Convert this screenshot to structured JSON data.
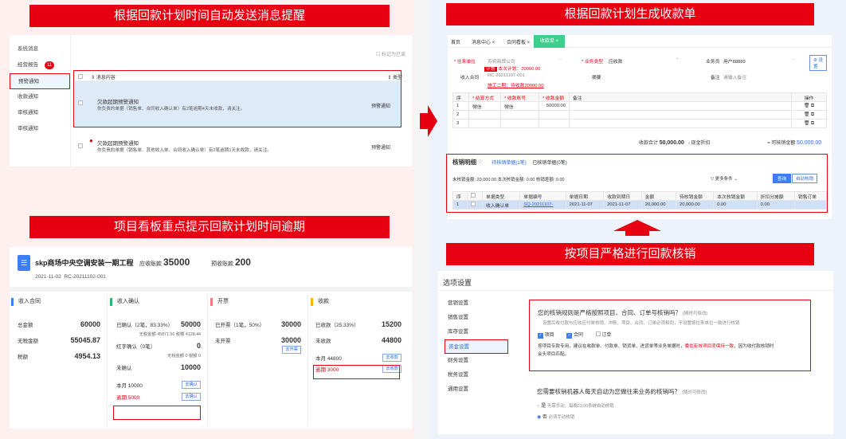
{
  "banners": {
    "b1": "根据回款计划时间自动发送消息提醒",
    "b2": "项目看板重点提示回款计划时间逾期",
    "b3": "根据回款计划生成收款单",
    "b4": "按项目严格进行回款核销"
  },
  "p1": {
    "sidebar": [
      {
        "label": "系统消息"
      },
      {
        "label": "经营报告",
        "badge": "11"
      },
      {
        "label": "预警通知"
      },
      {
        "label": "收款通知"
      },
      {
        "label": "审核通知"
      },
      {
        "label": "审核通知"
      }
    ],
    "mark_read": "标记为已读",
    "col_content": "消息内容",
    "col_type": "类型",
    "messages": [
      {
        "title": "欠款超期预警通知",
        "body": "你负责的单据（销售单、合同收入确认单）有2笔逾期4天未收款，请关注。",
        "type": "预警通知"
      },
      {
        "title": "欠款超期预警通知",
        "body": "你负责的单据（销售单、其他收入单、合同收入确认单）有2笔逾期1天未收款，请关注。",
        "type": "预警通知"
      }
    ]
  },
  "p2": {
    "title": "skp商场中央空调安装一期工程",
    "receivable_label": "应收账款",
    "receivable": "35000",
    "advance_label": "预收账款",
    "advance": "200",
    "date": "2021-11-02",
    "code": "RC-20211102-001",
    "cols": [
      {
        "head": "收入合同",
        "color": "#3d7df5",
        "rows": [
          {
            "k": "总金额",
            "v": "60000"
          },
          {
            "k": "无税金额",
            "v": "55045.87"
          },
          {
            "k": "税额",
            "v": "4954.13"
          }
        ]
      },
      {
        "head": "收入确认",
        "color": "#2bb673"
      },
      {
        "head": "开票",
        "color": "#f07c82",
        "rows": [
          {
            "k": "已开票（1笔，50%）",
            "v": "30000"
          },
          {
            "k": "未开票",
            "v": "30000"
          }
        ],
        "btn": "去开票"
      },
      {
        "head": "收款",
        "color": "#f5b400",
        "rows": [
          {
            "k": "已收款（25.33%）",
            "v": "15200"
          },
          {
            "k": "未收款",
            "v": "44800"
          }
        ]
      }
    ],
    "confirm": {
      "confirmed": "已确认（2笔，83.33%）",
      "confirmed_v": "50000",
      "no_tax": "无税金额 45871.56 税额 4128.44",
      "red": "红字确认（0笔）",
      "red_v": "0",
      "red_sub": "无税金额 0 税额 0",
      "unconfirmed": "未确认",
      "unconfirmed_v": "10000",
      "month": "本月 10000",
      "overdue": "逾期 5000",
      "btn1": "去确认",
      "btn2": "去确认"
    },
    "collect": {
      "month": "本月 44800",
      "overdue": "逾期 3000",
      "btn1": "去收款",
      "btn2": "去收款"
    }
  },
  "p3": {
    "tabs": [
      "首页",
      "消息中心 ×",
      "合同看板 ×",
      "收款单 ×"
    ],
    "f_unit_label": "* 往来单位",
    "f_unit_val": "苏玥商贸公司",
    "f_plan_tag": "计划",
    "f_plan_text": "本次计划：20000.00",
    "f_contract_label": "收入合同",
    "f_contract_val": "RC-20211107-001",
    "f_contract_sub": "施工二期：待收款20000.00",
    "f_biz_label": "* 业务类型",
    "f_biz_val": "应收款",
    "f_handler_label": "业务员",
    "f_handler_val": "用户88889",
    "f_summary_label": "摘要",
    "f_remark_label": "备注",
    "f_remark_val": "请输入备注",
    "setting_btn": "⚙ 设置",
    "t1_head": [
      "序",
      "* 结算方式",
      "* 收款账号",
      "* 收款金额",
      "备注",
      "操作"
    ],
    "t1_rows": [
      {
        "i": "1",
        "way": "微信",
        "acct": "微信",
        "amt": "50000.00"
      },
      {
        "i": "2",
        "way": "",
        "acct": "",
        "amt": ""
      },
      {
        "i": "3",
        "way": "",
        "acct": "",
        "amt": ""
      }
    ],
    "total_label": "收款合计",
    "total_val": "50,000.00",
    "cash_label": "- 现金折扣",
    "writeoff_label": "= 可核销金额",
    "writeoff_val": "50,000.00",
    "verify_title": "核销明细",
    "verify_tab1": "待核销单据(1笔)",
    "verify_tab2": "已核销单据(0笔)",
    "stats": "未核销金额: 20,000.00    本次核销金额: 0.00    核销差额: 0.00",
    "filter": "更多条件",
    "query": "查询",
    "auto": "自动核销",
    "t2_head": [
      "序",
      "",
      "单据类型",
      "单据编号",
      "单据日期",
      "收款到期日",
      "金额",
      "待核销金额",
      "本次核销金额",
      "折扣分摊额",
      "销售订单"
    ],
    "t2_row": [
      "1",
      "",
      "收入确认单",
      "SQ-20211107-",
      "2021-11-07",
      "2021-11-07",
      "20,000.00",
      "20,000.00",
      "0.00",
      "0.00",
      ""
    ]
  },
  "p4": {
    "title": "选项设置",
    "sidebar": [
      "营销设置",
      "销售设置",
      "库存设置",
      "资金设置",
      "财务设置",
      "税务设置",
      "通用设置"
    ],
    "active_index": 3,
    "q1": "您的核销规则是严格按照项目、合同、订单号核销吗？",
    "q1_note": "(随时可修改)",
    "q1_desc": "设置后收付款与应收应付单核销、冲账，项目、合同、订单必须相同，不设置按往来单位一致进行核销",
    "opts": [
      "项目",
      "合同",
      "订单"
    ],
    "q1_tip_a": "按项目专款专用，建议在收款单、付款单、销货单、进货单等业务单据时，",
    "q1_tip_red": "委估有效项目须保持一致",
    "q1_tip_b": "，因为收付款核销时",
    "q1_tip_c": "会头项目匹配。",
    "q2": "您需要核销机器人每天自动为您做往来业务的核销吗？",
    "q2_note": "(随时可修改)",
    "q2_yes": "是",
    "q2_yes_sub": "无需手动，每晚23:00系统自动核销",
    "q2_no": "否",
    "q2_no_sub": "必须手动核销"
  },
  "colors": {
    "accent": "#e60012",
    "blue": "#3d7df5"
  }
}
